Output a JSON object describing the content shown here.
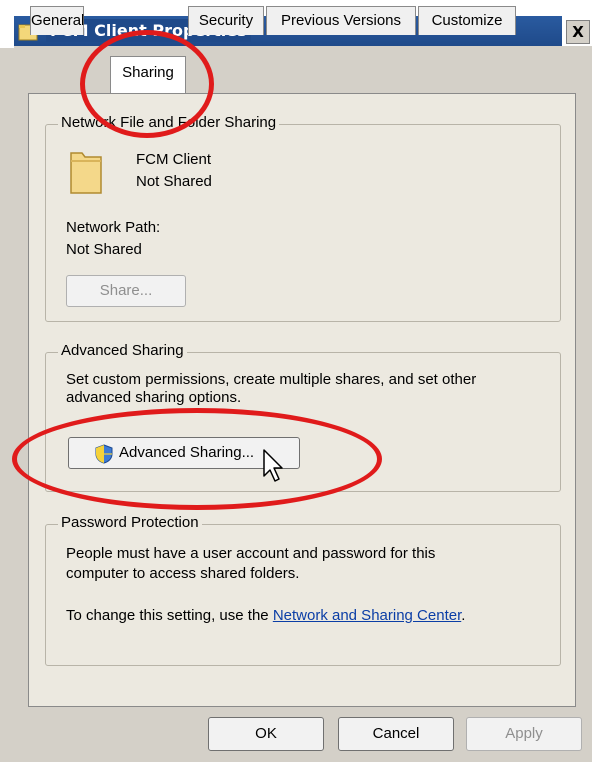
{
  "window": {
    "title": "FCM Client Properties",
    "close_label": "X"
  },
  "tabs": [
    {
      "label": "General",
      "active": false
    },
    {
      "label": "Sharing",
      "active": true
    },
    {
      "label": "Security",
      "active": false
    },
    {
      "label": "Previous Versions",
      "active": false
    },
    {
      "label": "Customize",
      "active": false
    }
  ],
  "network_sharing": {
    "group_label": "Network File and Folder Sharing",
    "folder_name": "FCM Client",
    "folder_status": "Not Shared",
    "path_label": "Network Path:",
    "path_value": "Not Shared",
    "share_button": "Share..."
  },
  "advanced_sharing": {
    "group_label": "Advanced Sharing",
    "description_line1": "Set custom permissions, create multiple shares, and set other",
    "description_line2": "advanced sharing options.",
    "button_label": "Advanced Sharing..."
  },
  "password_protection": {
    "group_label": "Password Protection",
    "line1": "People must have a user account and password for this",
    "line2": "computer to access shared folders.",
    "setting_prefix": "To change this setting, use the ",
    "setting_link": "Network and Sharing Center",
    "setting_suffix": "."
  },
  "footer": {
    "ok": "OK",
    "cancel": "Cancel",
    "apply": "Apply"
  },
  "colors": {
    "annotation": "#e01b1b",
    "link": "#0b3ea6",
    "titlebar": "#1f4a8a"
  }
}
